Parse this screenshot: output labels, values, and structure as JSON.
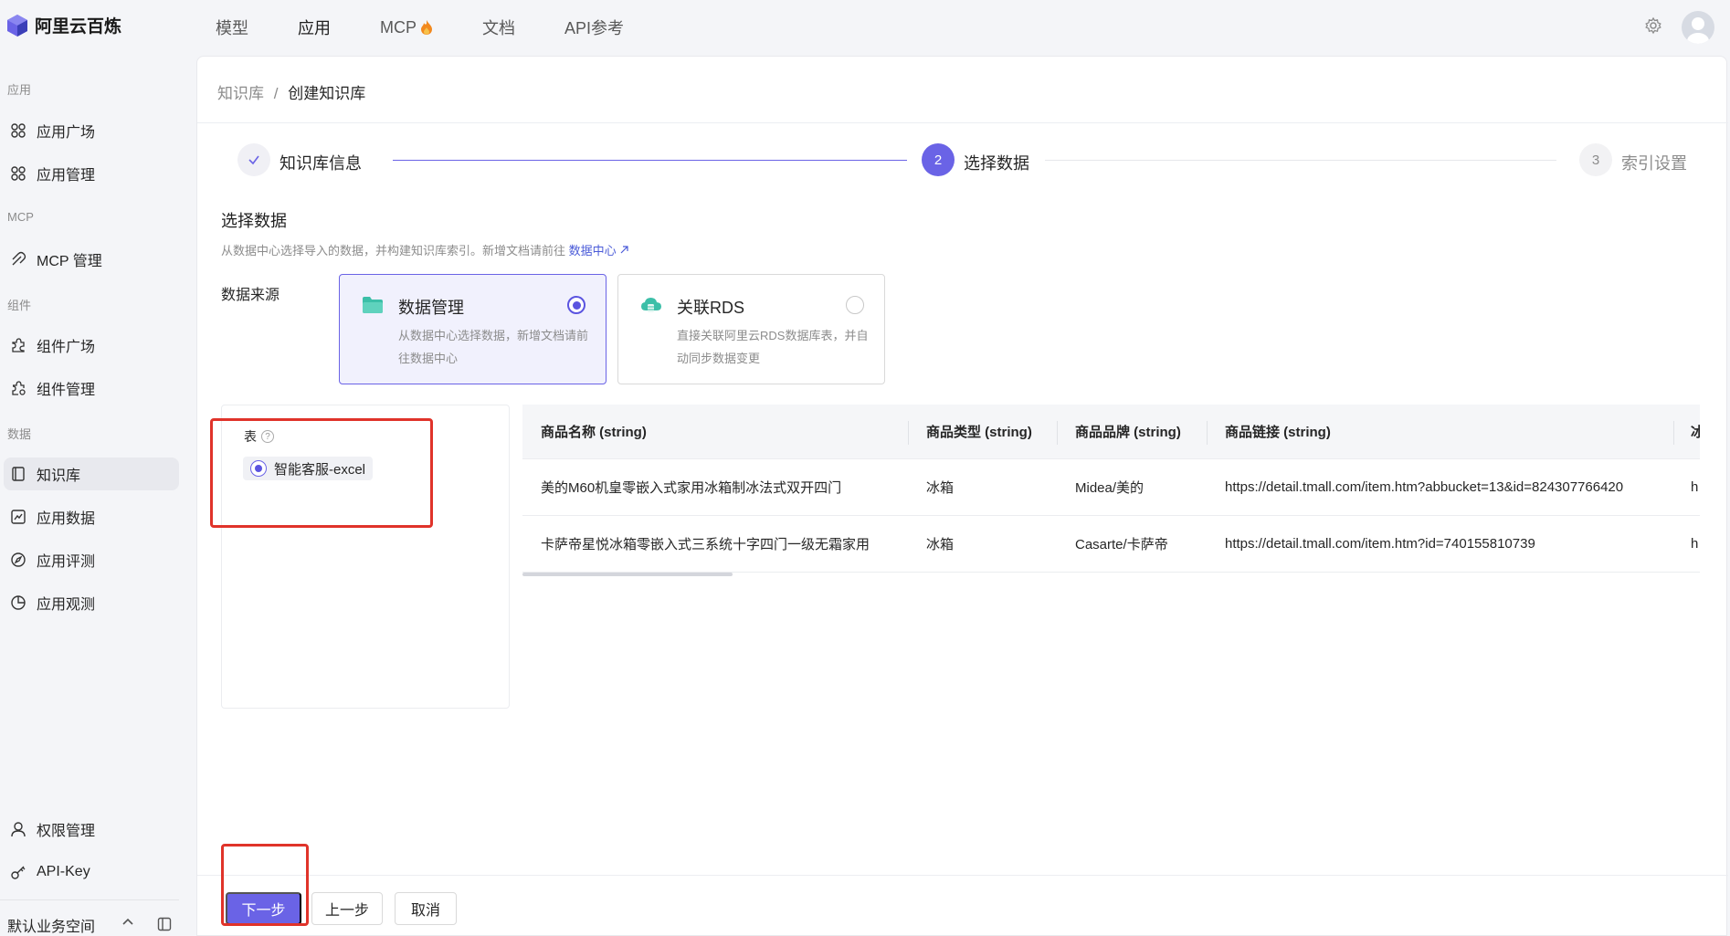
{
  "app": {
    "title": "阿里云百炼"
  },
  "topnav": {
    "items": [
      {
        "label": "模型"
      },
      {
        "label": "应用"
      },
      {
        "label": "MCP"
      },
      {
        "label": "文档"
      },
      {
        "label": "API参考"
      }
    ]
  },
  "sidebar": {
    "sections": {
      "apps": "应用",
      "mcp": "MCP",
      "components": "组件",
      "data": "数据"
    },
    "items": {
      "app_square": "应用广场",
      "app_manage": "应用管理",
      "mcp_manage": "MCP 管理",
      "comp_square": "组件广场",
      "comp_manage": "组件管理",
      "knowledge": "知识库",
      "app_data": "应用数据",
      "app_eval": "应用评测",
      "app_observe": "应用观测",
      "permission": "权限管理",
      "apikey": "API-Key"
    },
    "workspace": "默认业务空间"
  },
  "breadcrumb": {
    "root": "知识库",
    "sep": "/",
    "current": "创建知识库"
  },
  "steps": [
    {
      "label": "知识库信息",
      "status": "done"
    },
    {
      "num": "2",
      "label": "选择数据",
      "status": "active"
    },
    {
      "num": "3",
      "label": "索引设置",
      "status": "pending"
    }
  ],
  "select_data": {
    "title": "选择数据",
    "desc": "从数据中心选择导入的数据，并构建知识库索引。新增文档请前往",
    "link": "数据中心",
    "source_label": "数据来源",
    "sources": [
      {
        "title": "数据管理",
        "desc": "从数据中心选择数据，新增文档请前往数据中心",
        "selected": true
      },
      {
        "title": "关联RDS",
        "desc": "直接关联阿里云RDS数据库表，并自动同步数据变更",
        "selected": false
      }
    ]
  },
  "table_panel": {
    "header": "表",
    "help": "?",
    "selected_table": "智能客服-excel"
  },
  "data_table": {
    "columns": [
      "商品名称 (string)",
      "商品类型 (string)",
      "商品品牌 (string)",
      "商品链接 (string)",
      "冰"
    ],
    "rows": [
      [
        "美的M60机皇零嵌入式家用冰箱制冰法式双开四门",
        "冰箱",
        "Midea/美的",
        "https://detail.tmall.com/item.htm?abbucket=13&id=824307766420",
        "h"
      ],
      [
        "卡萨帝星悦冰箱零嵌入式三系统十字四门一级无霜家用",
        "冰箱",
        "Casarte/卡萨帝",
        "https://detail.tmall.com/item.htm?id=740155810739",
        "h"
      ]
    ]
  },
  "footer": {
    "next": "下一步",
    "prev": "上一步",
    "cancel": "取消"
  },
  "colors": {
    "accent": "#6a63e6",
    "highlight_box": "#e0332a"
  }
}
